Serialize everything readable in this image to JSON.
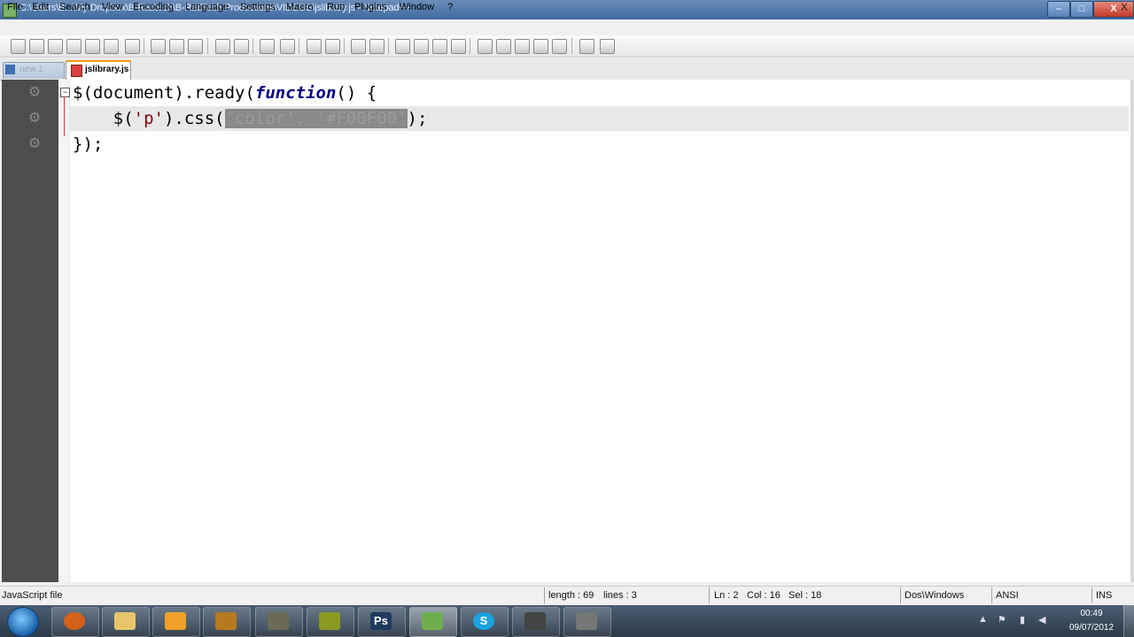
{
  "window": {
    "title": "C:\\Users\\B...\\My Dropbox\\B-Radtech\\B-RadTech Productions\\VIDEOS\\jslibrary.js - Notepad++",
    "controls": {
      "minimize": "–",
      "maximize": "□",
      "close": "X"
    }
  },
  "menu": {
    "items": [
      "File",
      "Edit",
      "Search",
      "View",
      "Encoding",
      "Language",
      "Settings",
      "Macro",
      "Run",
      "Plugins",
      "Window",
      "?"
    ],
    "close_label": "X"
  },
  "toolbar": {
    "icons": [
      "new-file-icon",
      "open-file-icon",
      "save-icon",
      "save-all-icon",
      "close-icon",
      "close-all-icon",
      "print-icon",
      "cut-icon",
      "copy-icon",
      "paste-icon",
      "undo-icon",
      "redo-icon",
      "find-icon",
      "replace-icon",
      "zoom-in-icon",
      "zoom-out-icon",
      "sync-vertical-icon",
      "sync-horizontal-icon",
      "word-wrap-icon",
      "show-all-chars-icon",
      "indent-guide-icon",
      "user-language-icon",
      "record-macro-icon",
      "stop-macro-icon",
      "play-macro-icon",
      "run-macro-multiple-icon",
      "save-macro-icon",
      "launch-browser-icon",
      "spell-check-icon"
    ]
  },
  "tabs": [
    {
      "label": "new 1",
      "active": false
    },
    {
      "label": "jslibrary.js",
      "active": true
    }
  ],
  "editor": {
    "lines": [
      {
        "parts": [
          "$(document).ready(",
          "function",
          "() {"
        ]
      },
      {
        "parts": [
          "    $(",
          "'p'",
          ").css(",
          "'color'",
          ", ",
          "'#F00F00'",
          ");"
        ]
      },
      {
        "parts": [
          "});"
        ]
      }
    ],
    "current_line": 2
  },
  "status": {
    "file_type": "JavaScript file",
    "length": "length : 69",
    "lines": "lines : 3",
    "ln": "Ln : 2",
    "col": "Col : 16",
    "sel": "Sel : 18",
    "eol": "Dos\\Windows",
    "encoding": "ANSI",
    "mode": "INS"
  },
  "taskbar": {
    "apps": [
      "firefox",
      "explorer",
      "outlook",
      "media-player",
      "generic-app",
      "generic-app-2",
      "photoshop",
      "notepad-plus-plus",
      "skype",
      "app-9",
      "app-10"
    ],
    "clock_time": "00:49",
    "clock_date": "09/07/2012"
  },
  "colors": {
    "keyword": "#000080",
    "string": "#800000",
    "selection": "#8a8a8a",
    "gutter": "#4d4d4d"
  }
}
